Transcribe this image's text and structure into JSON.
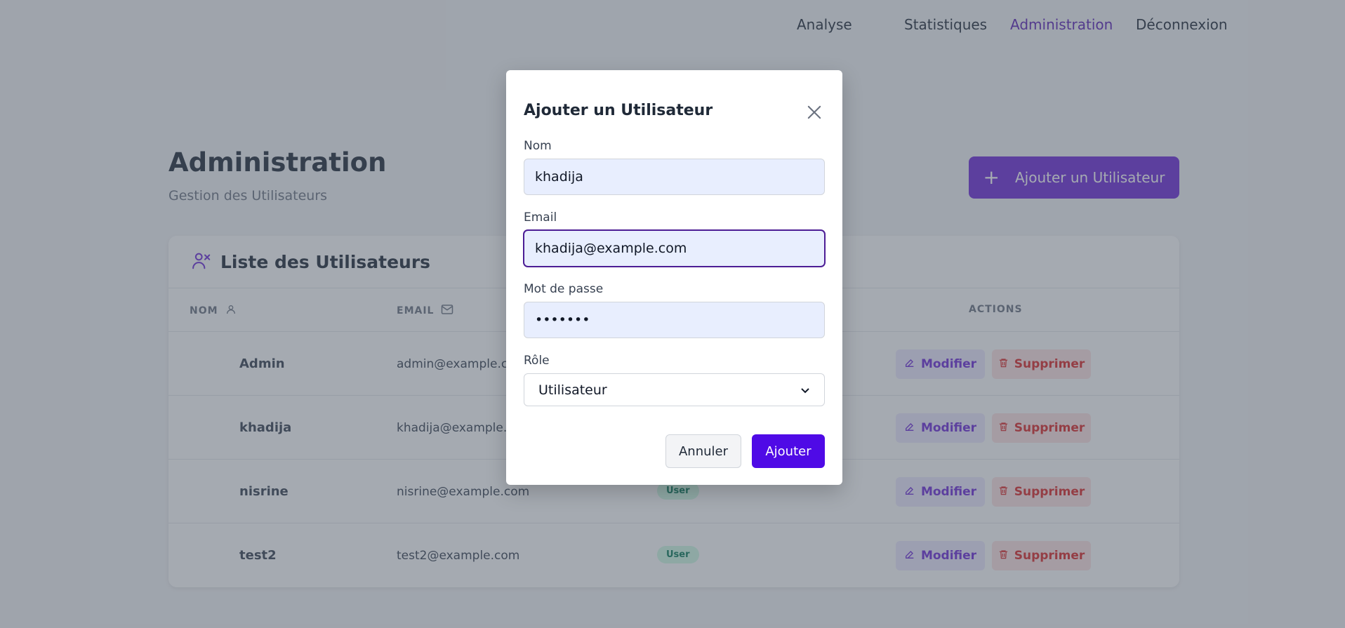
{
  "nav": {
    "items": [
      {
        "label": "Analyse"
      },
      {
        "label": "Statistiques"
      },
      {
        "label": "Administration",
        "active": true
      },
      {
        "label": "Déconnexion"
      }
    ]
  },
  "header": {
    "title": "Administration",
    "subtitle": "Gestion des Utilisateurs",
    "add_button_label": "Ajouter un Utilisateur"
  },
  "table": {
    "title": "Liste des Utilisateurs",
    "columns": {
      "name": "NOM",
      "email": "EMAIL",
      "actions": "ACTIONS"
    },
    "rows": [
      {
        "name": "Admin",
        "email": "admin@example.com",
        "role": "",
        "edit": "Modifier",
        "delete": "Supprimer"
      },
      {
        "name": "khadija",
        "email": "khadija@example.com",
        "role": "",
        "edit": "Modifier",
        "delete": "Supprimer"
      },
      {
        "name": "nisrine",
        "email": "nisrine@example.com",
        "role": "User",
        "edit": "Modifier",
        "delete": "Supprimer"
      },
      {
        "name": "test2",
        "email": "test2@example.com",
        "role": "User",
        "edit": "Modifier",
        "delete": "Supprimer"
      }
    ]
  },
  "modal": {
    "title": "Ajouter un Utilisateur",
    "fields": {
      "name_label": "Nom",
      "name_value": "khadija",
      "email_label": "Email",
      "email_value": "khadija@example.com",
      "password_label": "Mot de passe",
      "password_value": "•••••••",
      "role_label": "Rôle",
      "role_value": "Utilisateur"
    },
    "cancel_label": "Annuler",
    "submit_label": "Ajouter"
  },
  "colors": {
    "accent": "#6d28d9",
    "submit": "#4f0ae6",
    "overlay": "rgba(75,85,99,0.5)"
  }
}
